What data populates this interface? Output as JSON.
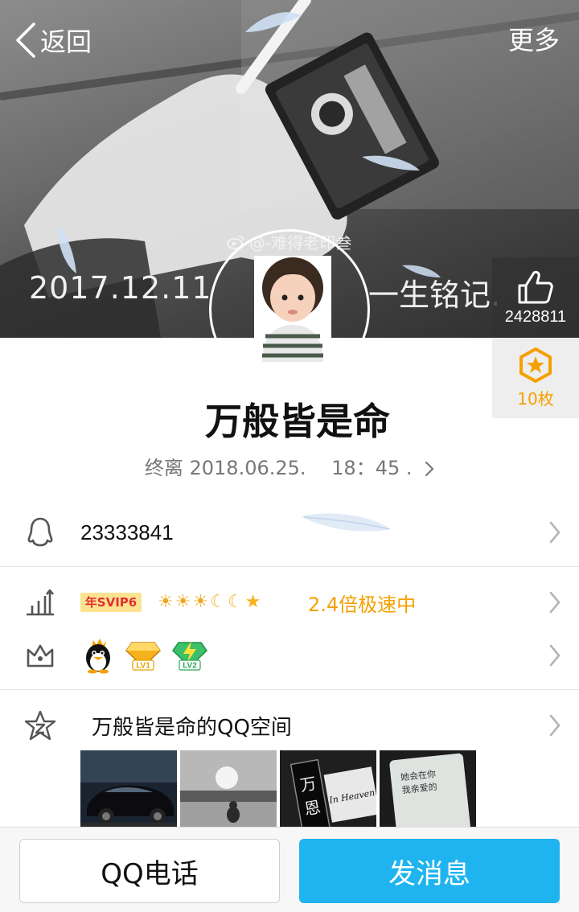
{
  "nav": {
    "back_label": "返回",
    "more_label": "更多"
  },
  "cover": {
    "watermark": "@-难得老印叁",
    "date_text": "2017.12.11",
    "motto_text": "一生铭记."
  },
  "likes": {
    "count": "2428811"
  },
  "badges": {
    "count": "10枚"
  },
  "profile": {
    "nickname": "万般皆是命",
    "signature": "终离 2018.06.25.　 18：45 ."
  },
  "qq": {
    "number": "23333841"
  },
  "level": {
    "svip_tag": "年SVIP6",
    "icons": [
      "sun",
      "sun",
      "sun",
      "moon",
      "moon",
      "star"
    ],
    "speed_text": "2.4倍极速中"
  },
  "vip": {
    "icons": [
      "qq-penguin-icon",
      "diamond-lv1-icon",
      "lightning-lv2-icon"
    ],
    "lv1_label": "LV1",
    "lv2_label": "LV2"
  },
  "qzone": {
    "title": "万般皆是命的QQ空间",
    "photo_texts": {
      "photo3_a": "万",
      "photo3_b": "恩",
      "photo3_c": "In Heaven",
      "photo4_a": "她会在你",
      "photo4_b": "我亲爱的"
    }
  },
  "actions": {
    "call_label": "QQ电话",
    "message_label": "发消息"
  },
  "colors": {
    "accent_blue": "#1fb4ef",
    "accent_orange": "#f5a000",
    "svip_bg": "#fbe390",
    "svip_text": "#e23030"
  }
}
